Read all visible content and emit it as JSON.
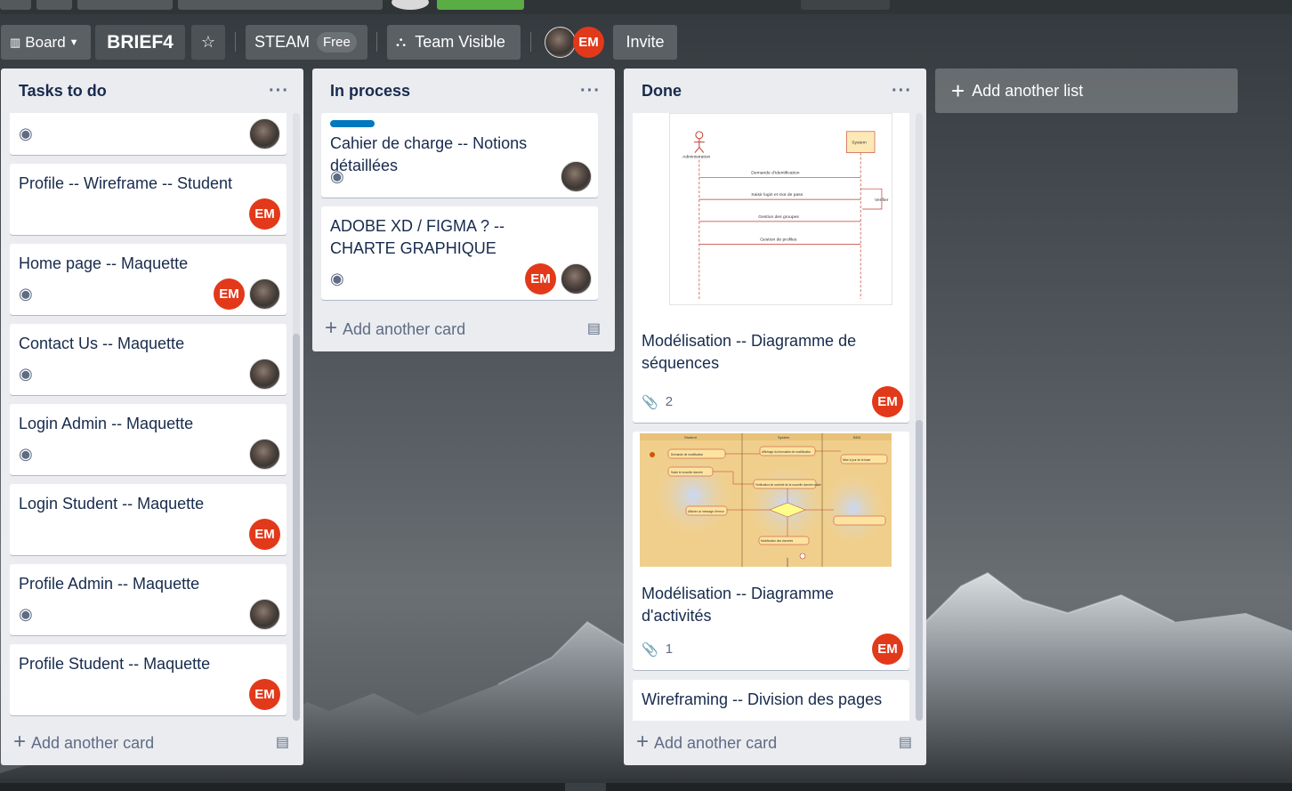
{
  "header": {
    "board_menu_label": "Board",
    "board_title": "BRIEF4",
    "team_name": "STEAM",
    "team_badge": "Free",
    "visibility_label": "Team Visible",
    "members": [
      {
        "type": "photo"
      },
      {
        "type": "initials",
        "text": "EM"
      }
    ],
    "invite_label": "Invite"
  },
  "lists": [
    {
      "title": "Tasks to do",
      "add_card_label": "Add another card",
      "cards": [
        {
          "title": "",
          "watch": true,
          "members": [
            "photo"
          ]
        },
        {
          "title": "Profile -- Wireframe -- Student",
          "watch": false,
          "members": [
            "EM"
          ]
        },
        {
          "title": "Home page -- Maquette",
          "watch": true,
          "members": [
            "EM",
            "photo"
          ]
        },
        {
          "title": "Contact Us -- Maquette",
          "watch": true,
          "members": [
            "photo"
          ]
        },
        {
          "title": "Login Admin -- Maquette",
          "watch": true,
          "members": [
            "photo"
          ]
        },
        {
          "title": "Login Student -- Maquette",
          "watch": false,
          "members": [
            "EM"
          ]
        },
        {
          "title": "Profile Admin -- Maquette",
          "watch": true,
          "members": [
            "photo"
          ]
        },
        {
          "title": "Profile Student -- Maquette",
          "watch": false,
          "members": [
            "EM"
          ]
        }
      ]
    },
    {
      "title": "In process",
      "add_card_label": "Add another card",
      "cards": [
        {
          "title": "Cahier de charge -- Notions détaillées",
          "label_color": "#0079bf",
          "watch": true,
          "members": [
            "photo"
          ]
        },
        {
          "title": "ADOBE XD / FIGMA ? -- CHARTE GRAPHIQUE",
          "watch": true,
          "members": [
            "EM",
            "photo"
          ]
        }
      ]
    },
    {
      "title": "Done",
      "add_card_label": "Add another card",
      "cards": [
        {
          "title": "Modélisation -- Diagramme de séquences",
          "attachments": "2",
          "members": [
            "EM"
          ],
          "cover": "sequence-diagram"
        },
        {
          "title": "Modélisation -- Diagramme d'activités",
          "attachments": "1",
          "members": [
            "EM"
          ],
          "cover": "activity-diagram"
        },
        {
          "title": "Wireframing -- Division des pages",
          "members": []
        }
      ]
    }
  ],
  "add_list_label": "Add another list",
  "diagram_text": {
    "sequence": {
      "actor": "Administration",
      "system": "System",
      "messages": [
        "Demande d'Identification",
        "Saisir login et mot de pass",
        "Verifier",
        "Gestion des groupes",
        "Gestion de profiles"
      ]
    },
    "activity": {
      "lanes": [
        "Student",
        "System",
        "BDD"
      ],
      "nodes": [
        "Demande de modification",
        "Affichage du formulaire de modification",
        "Saisir le nouvelle donnée",
        "Vérification de contrôle de la nouvelle donnée saisie",
        "Afficher un message d'erreur",
        "Modification des données",
        "Mise à jour de la base"
      ]
    }
  },
  "colors": {
    "accent": "#0079bf",
    "member_red": "#e2391a",
    "list_bg": "#ebecf0"
  }
}
